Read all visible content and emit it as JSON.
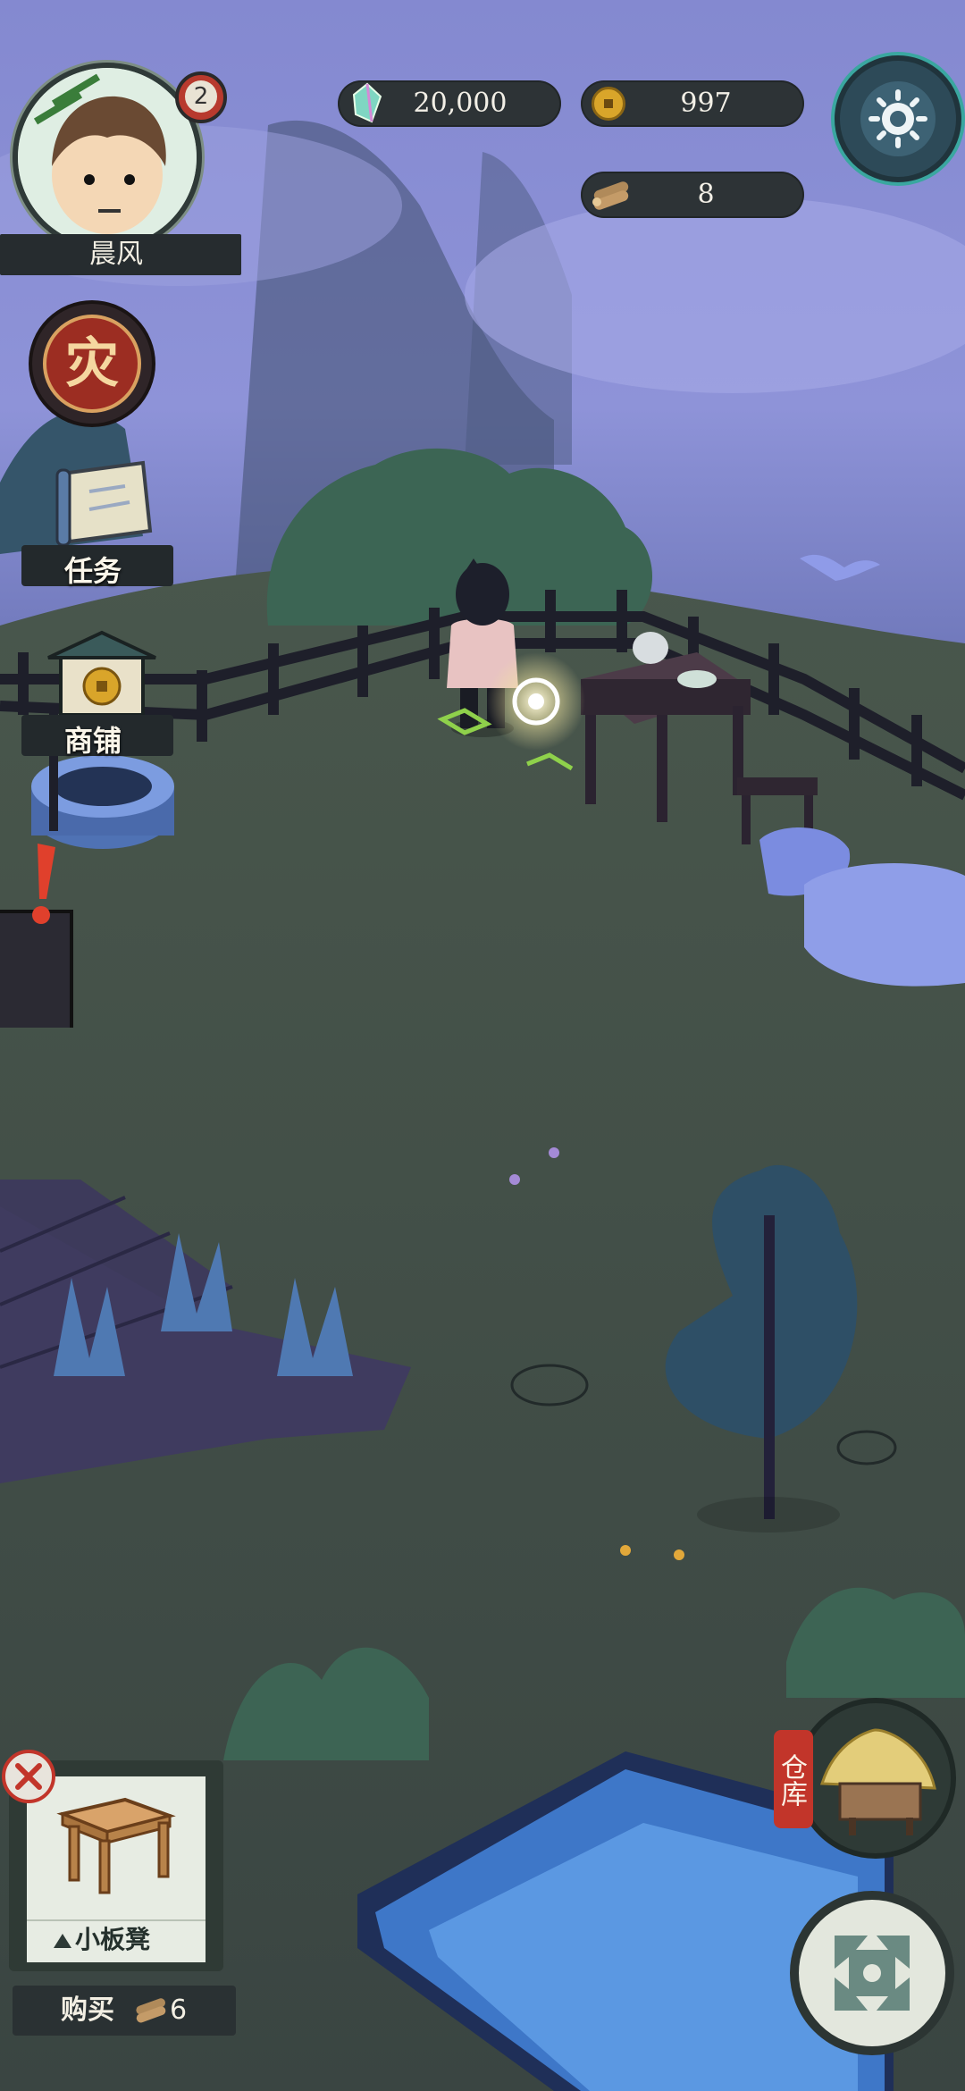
{
  "player": {
    "name": "晨风",
    "level_badge": "2"
  },
  "currencies": {
    "crystal": {
      "icon": "crystal-icon",
      "value": "20,000"
    },
    "coins": {
      "icon": "copper-coin-icon",
      "value": "997"
    },
    "wood": {
      "icon": "wood-log-icon",
      "value": "8"
    }
  },
  "side_menu": {
    "event_glyph": "灾",
    "quest_label": "任务",
    "shop_label": "商铺"
  },
  "warehouse": {
    "label": "仓库"
  },
  "build_card": {
    "item_name": "小板凳",
    "buy_label": "购买",
    "price": "6",
    "price_icon": "wood-log-icon"
  },
  "colors": {
    "hud_pill": "#2d3336",
    "fog": "#8e93d6",
    "grass": "#3f4d47",
    "water": "#4a86d6",
    "coin_gold": "#d9a52a",
    "alert_red": "#e0402c"
  }
}
